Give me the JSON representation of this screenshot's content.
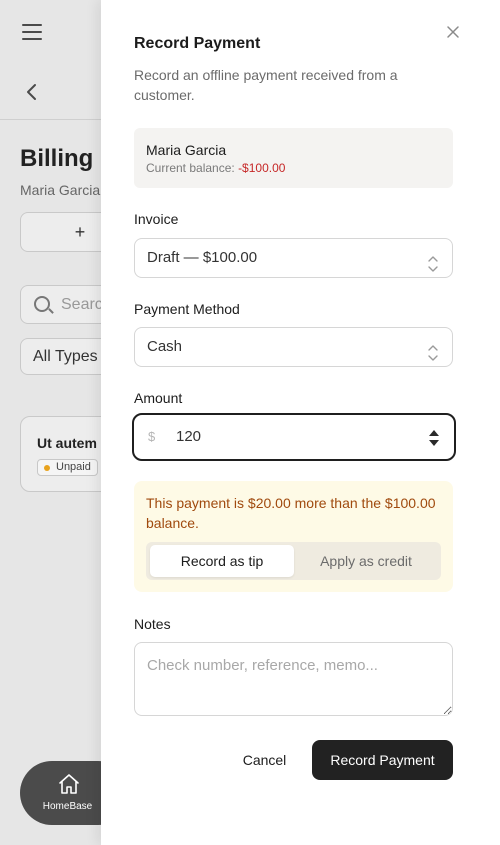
{
  "background": {
    "title": "Billing H",
    "subtitle": "Maria Garcia",
    "add_label": "+",
    "search_placeholder": "Searc",
    "filter_value": "All Types",
    "card_title": "Ut autem",
    "card_status": "Unpaid",
    "home_label": "HomeBase"
  },
  "drawer": {
    "title": "Record Payment",
    "description": "Record an offline payment received from a customer.",
    "customer": {
      "name": "Maria Garcia",
      "balance_label": "Current balance:",
      "balance_value": "-$100.00"
    },
    "invoice": {
      "label": "Invoice",
      "value": "Draft — $100.00"
    },
    "method": {
      "label": "Payment Method",
      "value": "Cash"
    },
    "amount": {
      "label": "Amount",
      "currency": "$",
      "value": "120"
    },
    "warning": {
      "text": "This payment is $20.00 more than the $100.00 balance.",
      "options": [
        "Record as tip",
        "Apply as credit"
      ],
      "selected": "Record as tip"
    },
    "notes": {
      "label": "Notes",
      "placeholder": "Check number, reference, memo..."
    },
    "cancel_label": "Cancel",
    "submit_label": "Record Payment"
  },
  "colors": {
    "primary_button": "#222222",
    "negative_balance": "#c62828",
    "warning_bg": "#fefae6",
    "warning_text": "#a04a0e"
  }
}
